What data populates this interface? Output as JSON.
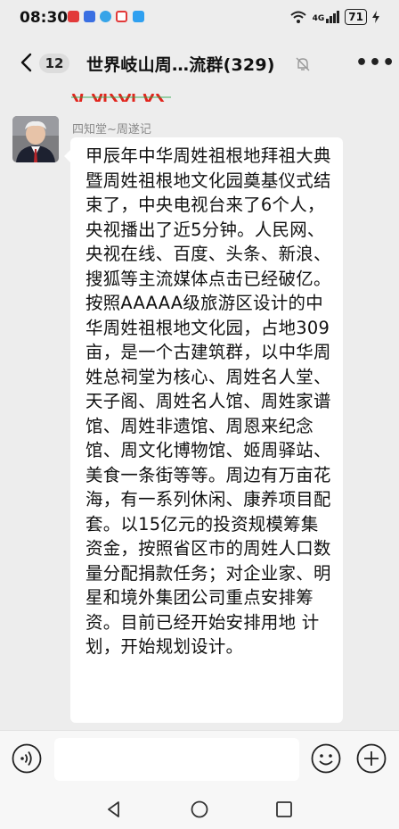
{
  "status_bar": {
    "time": "08:30",
    "battery": "71",
    "signal_text": "4G"
  },
  "header": {
    "back_badge": "12",
    "title": "世界岐山周…流群(329)"
  },
  "message": {
    "sender": "四知堂~周遂记",
    "text": "甲辰年中华周姓祖根地拜祖大典暨周姓祖根地文化园奠基仪式结束了，中央电视台来了6个人，央视播出了近5分钟。人民网、央视在线、百度、头条、新浪、搜狐等主流媒体点击已经破亿。按照AAAAA级旅游区设计的中华周姓祖根地文化园，占地309亩，是一个古建筑群，以中华周姓总祠堂为核心、周姓名人堂、天子阁、周姓名人馆、周姓家谱馆、周姓非遗馆、周恩来纪念馆、周文化博物馆、姬周驿站、美食一条街等等。周边有万亩花海，有一系列休闲、康养项目配套。以15亿元的投资规模筹集资金，按照省区市的周姓人口数量分配捐款任务；对企业家、明星和境外集团公司重点安排筹资。目前已经开始安排用地 计划，开始规划设计。"
  },
  "input_bar": {
    "placeholder": ""
  },
  "colors": {
    "background": "#ededed",
    "bubble": "#ffffff",
    "sender": "#8a8a8a"
  }
}
